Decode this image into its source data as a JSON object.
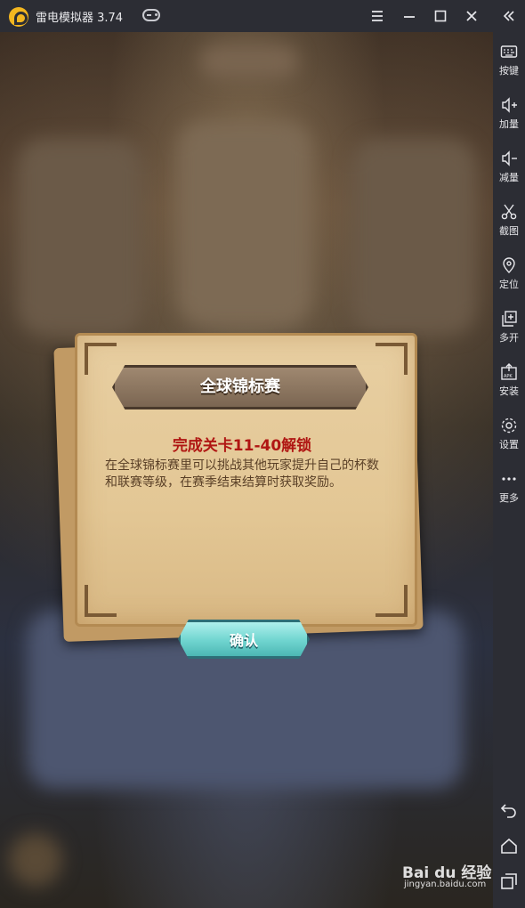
{
  "titlebar": {
    "app_title": "雷电模拟器 3.74"
  },
  "dialog": {
    "title": "全球锦标赛",
    "unlock_text": "完成关卡11-40解锁",
    "description": "在全球锦标赛里可以挑战其他玩家提升自己的杯数和联赛等级，在赛季结束结算时获取奖励。",
    "confirm_label": "确认"
  },
  "sidebar": {
    "items": [
      {
        "label": "按键",
        "icon": "keyboard-icon"
      },
      {
        "label": "加量",
        "icon": "volume-up-icon"
      },
      {
        "label": "减量",
        "icon": "volume-down-icon"
      },
      {
        "label": "截图",
        "icon": "scissors-icon"
      },
      {
        "label": "定位",
        "icon": "location-pin-icon"
      },
      {
        "label": "多开",
        "icon": "multi-window-icon"
      },
      {
        "label": "安装",
        "icon": "apk-install-icon"
      },
      {
        "label": "设置",
        "icon": "gear-icon"
      },
      {
        "label": "更多",
        "icon": "more-dots-icon"
      }
    ]
  },
  "watermark": {
    "main": "Bai du 经验",
    "sub": "jingyan.baidu.com"
  },
  "colors": {
    "titlebar_bg": "#2c2d34",
    "unlock_text": "#b01613",
    "confirm_button": "#6fd4cf"
  }
}
